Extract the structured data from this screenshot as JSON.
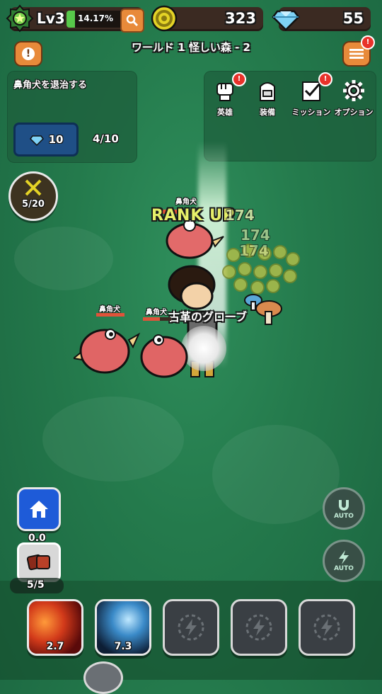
{
  "player": {
    "level": "Lv3",
    "exp_percent": "14.17%",
    "exp_fraction": 0.1417
  },
  "currency": {
    "coins": "323",
    "gems": "55"
  },
  "stage": {
    "title": "ワールド 1 怪しい森 - 2"
  },
  "quest": {
    "text": "鼻角犬を退治する",
    "reward": "10",
    "progress": "4/10"
  },
  "menu": [
    {
      "label": "英雄",
      "alert": "!"
    },
    {
      "label": "装備",
      "alert": ""
    },
    {
      "label": "ミッション",
      "alert": "!"
    },
    {
      "label": "オプション",
      "alert": ""
    }
  ],
  "kills": {
    "count": "5/20"
  },
  "battle": {
    "enemy_label": "鼻角犬",
    "rank_up": "RANK UP",
    "damage": [
      "174",
      "174",
      "174"
    ],
    "loot": "古革のグローブ"
  },
  "left": {
    "potion_timer": "0.0",
    "potion_count": "5/5"
  },
  "right": {
    "auto_magnet": "AUTO",
    "auto_skill": "AUTO"
  },
  "skills": [
    {
      "cooldown": "2.7",
      "state": "ready"
    },
    {
      "cooldown": "7.3",
      "state": "ready"
    },
    {
      "cooldown": "",
      "state": "locked"
    },
    {
      "cooldown": "",
      "state": "locked"
    },
    {
      "cooldown": "",
      "state": "locked"
    }
  ],
  "colors": {
    "exp": "#57c84a",
    "coin": "#e4d326",
    "gem": "#7fd2f5",
    "panel": "#1e5f3c",
    "alert": "#e8322b"
  }
}
